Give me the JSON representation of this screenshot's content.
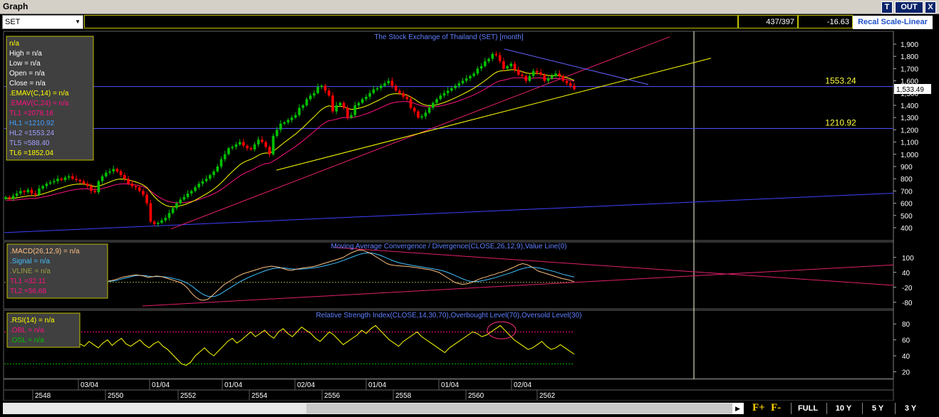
{
  "window": {
    "title": "Graph",
    "btn_t": "T",
    "btn_out": "OUT",
    "btn_x": "X"
  },
  "toolbar": {
    "symbol": "SET",
    "count": "437/397",
    "change": "-16.63",
    "recal": "Recal Scale-Linear"
  },
  "bottom": {
    "full": "FULL",
    "y10": "10 Y",
    "y5": "5 Y",
    "y3": "3 Y",
    "fplus": "F+",
    "fminus": "F-"
  },
  "colors": {
    "bg": "#000000",
    "candle_up": "#00c000",
    "candle_down": "#ff0000",
    "emav14": "#ffff00",
    "emav24": "#ff1080",
    "macd": "#ffc080",
    "signal": "#40c0ff",
    "rsi": "#ffff00",
    "trend_pink": "#e0206a",
    "trend_yellow": "#ffff00",
    "trend_blue": "#4040ff"
  },
  "chart_data": [
    {
      "type": "candlestick",
      "title": "The Stock Exchange of Thailand (SET) [month]",
      "ylim": [
        300,
        1950
      ],
      "yticks": [
        "1,900",
        "1,800",
        "1,700",
        "1,600",
        "1,500",
        "1,400",
        "1,300",
        "1,200",
        "1,100",
        "1,000",
        "900",
        "800",
        "700",
        "600",
        "500",
        "400"
      ],
      "last_value": "1,533.49",
      "hlines": [
        {
          "label": "1553.24",
          "value": 1553.24
        },
        {
          "label": "1210.92",
          "value": 1210.92
        }
      ],
      "legend": [
        {
          "text": "n/a",
          "color": "#ffff00"
        },
        {
          "text": "High  = n/a",
          "color": "#ffffff"
        },
        {
          "text": "Low   = n/a",
          "color": "#ffffff"
        },
        {
          "text": "Open  = n/a",
          "color": "#ffffff"
        },
        {
          "text": "Close  = n/a",
          "color": "#ffffff"
        },
        {
          "text": ".EMAV(C,14)   = n/a",
          "color": "#ffff00"
        },
        {
          "text": ".EMAV(C,24)   = n/a",
          "color": "#ff1080"
        },
        {
          "text": "TL1 =2078.16",
          "color": "#ff1080"
        },
        {
          "text": "HL1 =1210.92",
          "color": "#40a0ff"
        },
        {
          "text": "HL2 =1553.24",
          "color": "#a0a0ff"
        },
        {
          "text": "TL5 =588.40",
          "color": "#a0a0ff"
        },
        {
          "text": "TL6 =1852.04",
          "color": "#ffff00"
        }
      ],
      "closes": [
        650,
        640,
        660,
        680,
        700,
        690,
        710,
        680,
        670,
        720,
        740,
        760,
        770,
        780,
        800,
        790,
        810,
        820,
        800,
        790,
        780,
        760,
        740,
        700,
        690,
        780,
        820,
        850,
        860,
        880,
        860,
        830,
        800,
        760,
        740,
        730,
        700,
        670,
        600,
        450,
        430,
        440,
        460,
        480,
        520,
        560,
        600,
        630,
        650,
        680,
        700,
        730,
        760,
        780,
        800,
        830,
        860,
        900,
        960,
        1000,
        1050,
        1060,
        1080,
        1100,
        1070,
        1050,
        1040,
        1080,
        1120,
        1100,
        1060,
        1000,
        1150,
        1200,
        1250,
        1260,
        1280,
        1300,
        1320,
        1380,
        1400,
        1450,
        1480,
        1500,
        1550,
        1560,
        1520,
        1480,
        1350,
        1400,
        1420,
        1380,
        1300,
        1320,
        1400,
        1420,
        1450,
        1470,
        1500,
        1530,
        1540,
        1560,
        1580,
        1600,
        1560,
        1520,
        1500,
        1470,
        1450,
        1380,
        1350,
        1300,
        1310,
        1340,
        1380,
        1420,
        1450,
        1480,
        1500,
        1520,
        1540,
        1560,
        1580,
        1600,
        1620,
        1640,
        1660,
        1700,
        1720,
        1760,
        1780,
        1820,
        1810,
        1760,
        1700,
        1720,
        1740,
        1690,
        1650,
        1640,
        1600,
        1640,
        1680,
        1670,
        1650,
        1600,
        1620,
        1640,
        1660,
        1640,
        1600,
        1580,
        1560,
        1533
      ]
    },
    {
      "type": "line",
      "title": "Moving Average Convergence / Divergence(CLOSE,26,12,9),Value Line(0)",
      "ylim": [
        -95,
        145
      ],
      "yticks": [
        "100",
        "40",
        "-20",
        "-80"
      ],
      "legend": [
        {
          "text": ".MACD(26,12,9)   = n/a",
          "color": "#ffc080"
        },
        {
          "text": ".Signal  = n/a",
          "color": "#40c0ff"
        },
        {
          "text": ".VLINE   = n/a",
          "color": "#a0a040"
        },
        {
          "text": "TL1 =32.11",
          "color": "#ff1080"
        },
        {
          "text": "TL2 =56.68",
          "color": "#ff1080"
        }
      ],
      "macd": [
        5,
        8,
        12,
        18,
        22,
        25,
        28,
        30,
        28,
        25,
        20,
        22,
        25,
        24,
        20,
        15,
        10,
        5,
        0,
        -10,
        -25,
        -45,
        -60,
        -70,
        -72,
        -68,
        -55,
        -40,
        -25,
        -10,
        0,
        10,
        20,
        28,
        35,
        40,
        45,
        50,
        55,
        60,
        62,
        65,
        63,
        60,
        55,
        50,
        48,
        52,
        55,
        58,
        60,
        62,
        65,
        70,
        75,
        80,
        85,
        90,
        95,
        100,
        110,
        118,
        125,
        130,
        128,
        122,
        115,
        105,
        95,
        85,
        75,
        70,
        68,
        66,
        65,
        64,
        62,
        60,
        58,
        55,
        52,
        50,
        45,
        40,
        30,
        20,
        10,
        0,
        -5,
        -8,
        -6,
        -2,
        5,
        12,
        18,
        22,
        28,
        32,
        38,
        42,
        48,
        55,
        62,
        70,
        75,
        72,
        65,
        55,
        45,
        40,
        35,
        30,
        25,
        20,
        15,
        12,
        8,
        2
      ],
      "signal": [
        3,
        5,
        8,
        12,
        16,
        20,
        24,
        27,
        28,
        27,
        25,
        23,
        23,
        23,
        22,
        20,
        17,
        13,
        9,
        3,
        -5,
        -15,
        -28,
        -40,
        -50,
        -56,
        -58,
        -55,
        -48,
        -38,
        -28,
        -18,
        -8,
        2,
        10,
        18,
        25,
        32,
        38,
        44,
        50,
        54,
        57,
        58,
        58,
        56,
        54,
        53,
        53,
        54,
        55,
        57,
        59,
        62,
        65,
        69,
        73,
        77,
        82,
        88,
        94,
        100,
        106,
        112,
        116,
        118,
        118,
        115,
        110,
        104,
        97,
        90,
        84,
        79,
        75,
        72,
        69,
        66,
        64,
        61,
        58,
        56,
        53,
        50,
        46,
        41,
        35,
        28,
        21,
        14,
        8,
        4,
        3,
        4,
        7,
        10,
        14,
        18,
        23,
        28,
        33,
        38,
        44,
        50,
        55,
        59,
        61,
        60,
        58,
        55,
        51,
        47,
        43,
        38,
        33,
        29,
        25,
        21
      ]
    },
    {
      "type": "line",
      "title": "Relative Strength Index(CLOSE,14,30,70),Overbought Level(70),Oversold Level(30)",
      "ylim": [
        15,
        90
      ],
      "yticks": [
        "80",
        "60",
        "40",
        "20"
      ],
      "overbought": 70,
      "oversold": 30,
      "legend": [
        {
          "text": ".RSI(14)   = n/a",
          "color": "#ffff00"
        },
        {
          "text": ".OBL   = n/a",
          "color": "#ff1080"
        },
        {
          "text": ".OSL   = n/a",
          "color": "#00c000"
        }
      ],
      "rsi": [
        55,
        52,
        58,
        54,
        50,
        56,
        60,
        53,
        58,
        62,
        55,
        52,
        56,
        60,
        54,
        50,
        55,
        58,
        52,
        48,
        42,
        36,
        30,
        28,
        32,
        40,
        45,
        50,
        44,
        40,
        46,
        52,
        58,
        62,
        56,
        60,
        65,
        70,
        64,
        68,
        72,
        66,
        62,
        70,
        74,
        68,
        64,
        70,
        76,
        72,
        68,
        62,
        58,
        64,
        70,
        66,
        60,
        54,
        58,
        62,
        66,
        72,
        68,
        74,
        78,
        72,
        66,
        60,
        56,
        52,
        58,
        62,
        66,
        70,
        64,
        60,
        56,
        52,
        48,
        44,
        50,
        54,
        58,
        62,
        66,
        70,
        68,
        64,
        66,
        70,
        74,
        78,
        72,
        66,
        60,
        56,
        52,
        48,
        50,
        54,
        58,
        52,
        48,
        50,
        54,
        50,
        46,
        42
      ]
    }
  ],
  "xaxis": {
    "months": [
      "03/04",
      "01/04",
      "01/04",
      "02/04",
      "01/04",
      "01/04",
      "02/04"
    ],
    "years": [
      "2548",
      "2550",
      "2552",
      "2554",
      "2556",
      "2558",
      "2560",
      "2562"
    ]
  }
}
